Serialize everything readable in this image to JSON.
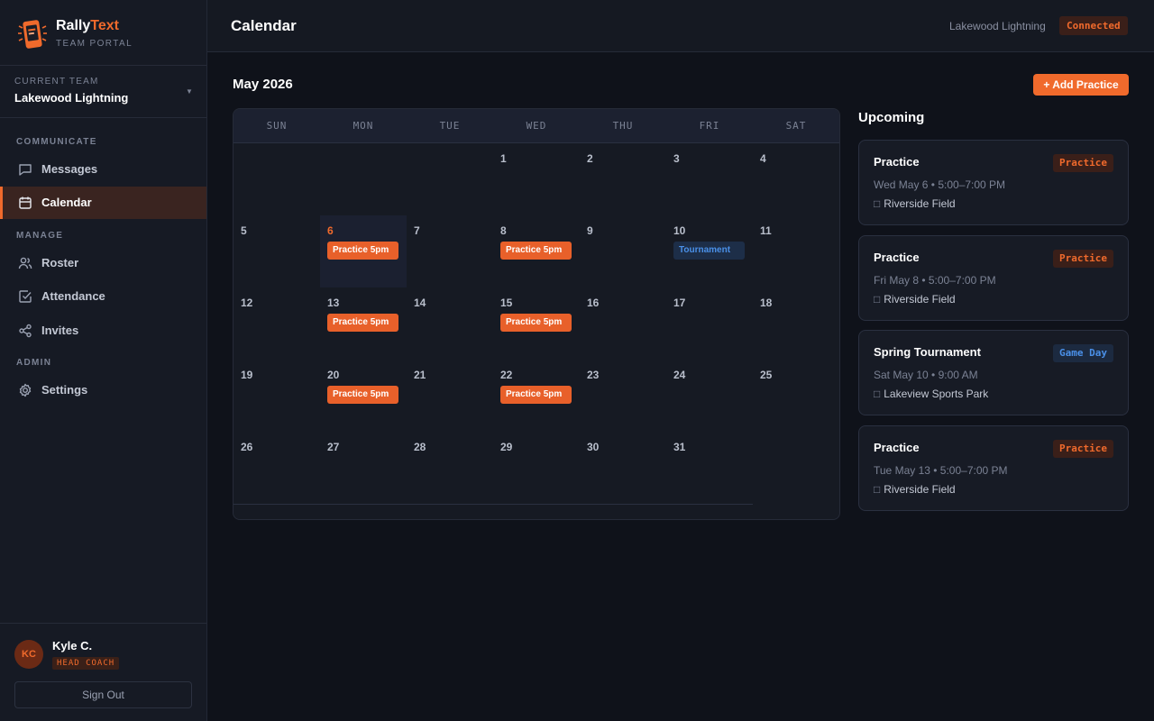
{
  "brand": {
    "name_a": "Rally",
    "name_b": "Text",
    "subtitle": "TEAM PORTAL"
  },
  "team_switch": {
    "label": "CURRENT TEAM",
    "name": "Lakewood Lightning"
  },
  "nav": {
    "sections": {
      "communicate": "COMMUNICATE",
      "manage": "MANAGE",
      "admin": "ADMIN"
    },
    "items": [
      {
        "label": "Messages",
        "icon": "message-icon"
      },
      {
        "label": "Calendar",
        "icon": "calendar-icon",
        "active": true
      },
      {
        "label": "Roster",
        "icon": "users-icon"
      },
      {
        "label": "Attendance",
        "icon": "check-square-icon"
      },
      {
        "label": "Invites",
        "icon": "share-icon"
      },
      {
        "label": "Settings",
        "icon": "gear-icon"
      }
    ]
  },
  "user": {
    "initials": "KC",
    "name": "Kyle C.",
    "role": "HEAD COACH",
    "signout": "Sign Out"
  },
  "header": {
    "title": "Calendar",
    "team": "Lakewood Lightning",
    "status": "Connected"
  },
  "calendar": {
    "month": "May 2026",
    "add_button": "+ Add Practice",
    "weekdays": [
      "SUN",
      "MON",
      "TUE",
      "WED",
      "THU",
      "FRI",
      "SAT"
    ],
    "days": [
      "",
      "",
      "",
      "1",
      "2",
      "3",
      "4",
      "5",
      "6",
      "7",
      "8",
      "9",
      "10",
      "11",
      "12",
      "13",
      "14",
      "15",
      "16",
      "17",
      "18",
      "19",
      "20",
      "21",
      "22",
      "23",
      "24",
      "25",
      "26",
      "27",
      "28",
      "29",
      "30",
      "31",
      ""
    ],
    "today": "6",
    "events": [
      {
        "day": "6",
        "label": "Practice 5pm",
        "kind": "practice"
      },
      {
        "day": "8",
        "label": "Practice 5pm",
        "kind": "practice"
      },
      {
        "day": "10",
        "label": "Tournament",
        "kind": "game"
      },
      {
        "day": "13",
        "label": "Practice 5pm",
        "kind": "practice"
      },
      {
        "day": "15",
        "label": "Practice 5pm",
        "kind": "practice"
      },
      {
        "day": "20",
        "label": "Practice 5pm",
        "kind": "practice"
      },
      {
        "day": "22",
        "label": "Practice 5pm",
        "kind": "practice"
      }
    ]
  },
  "upcoming": {
    "title": "Upcoming",
    "items": [
      {
        "title": "Practice",
        "tag": "Practice",
        "kind": "practice",
        "when": "Wed May 6 • 5:00–7:00 PM",
        "where": "Riverside Field"
      },
      {
        "title": "Practice",
        "tag": "Practice",
        "kind": "practice",
        "when": "Fri May 8 • 5:00–7:00 PM",
        "where": "Riverside Field"
      },
      {
        "title": "Spring Tournament",
        "tag": "Game Day",
        "kind": "game",
        "when": "Sat May 10 • 9:00 AM",
        "where": "Lakeview Sports Park"
      },
      {
        "title": "Practice",
        "tag": "Practice",
        "kind": "practice",
        "when": "Tue May 13 • 5:00–7:00 PM",
        "where": "Riverside Field"
      }
    ]
  },
  "colors": {
    "accent": "#f06a2c",
    "game": "#4a90e8",
    "background": "#0f121a",
    "sidebar": "#161a24"
  }
}
